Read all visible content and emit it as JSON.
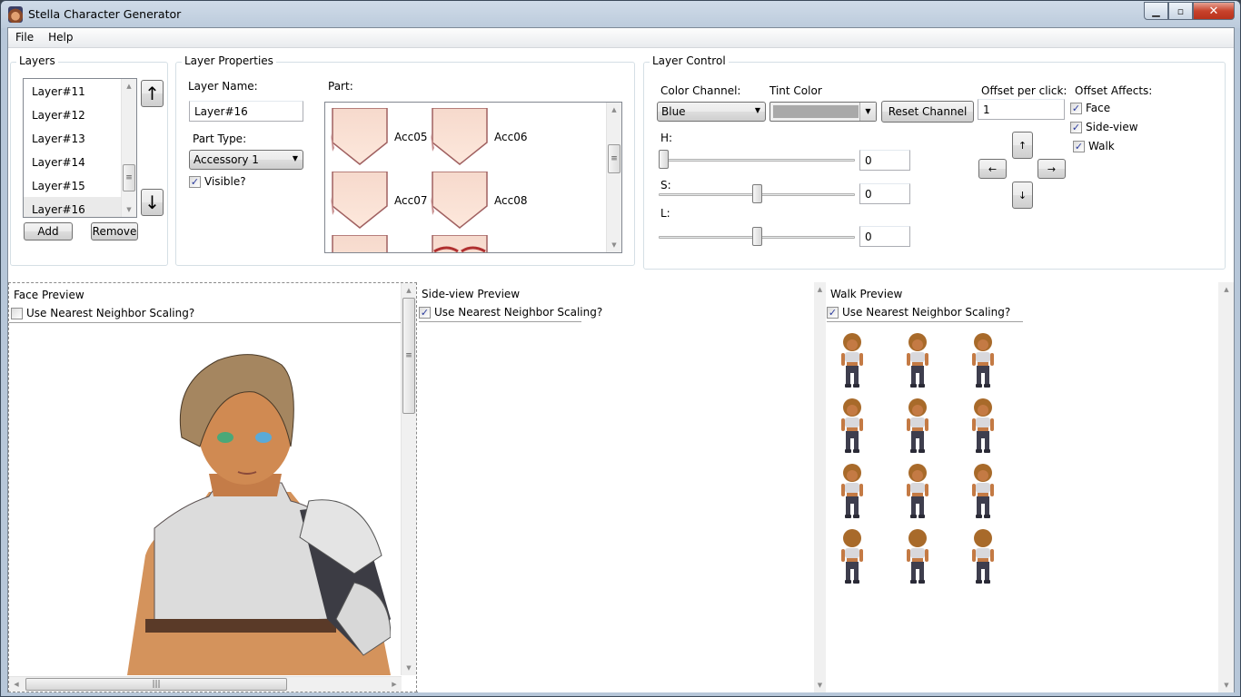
{
  "window": {
    "title": "Stella Character Generator",
    "controls": {
      "minimize": "▁",
      "maximize": "▫",
      "close": "✕"
    }
  },
  "menu": [
    {
      "label": "File"
    },
    {
      "label": "Help"
    }
  ],
  "layers": {
    "legend": "Layers",
    "items": [
      "Layer#11",
      "Layer#12",
      "Layer#13",
      "Layer#14",
      "Layer#15",
      "Layer#16"
    ],
    "selected": "Layer#16",
    "move_up": "↑",
    "move_down": "↓",
    "add_label": "Add",
    "remove_label": "Remove"
  },
  "layer_properties": {
    "legend": "Layer Properties",
    "name_label": "Layer Name:",
    "name_value": "Layer#16",
    "part_type_label": "Part Type:",
    "part_type_value": "Accessory 1",
    "visible_label": "Visible?",
    "visible_checked": true,
    "part_label": "Part:",
    "parts": [
      {
        "name": "Acc05"
      },
      {
        "name": "Acc06"
      },
      {
        "name": "Acc07"
      },
      {
        "name": "Acc08"
      },
      {
        "name": ""
      },
      {
        "name": ""
      }
    ]
  },
  "layer_control": {
    "legend": "Layer Control",
    "color_channel_label": "Color Channel:",
    "color_channel_value": "Blue",
    "tint_label": "Tint Color",
    "tint_color": "#a9a9a9",
    "reset_label": "Reset Channel",
    "h_label": "H:",
    "h_value": "0",
    "h_fraction": 0.0,
    "s_label": "S:",
    "s_value": "0",
    "s_fraction": 0.5,
    "l_label": "L:",
    "l_value": "0",
    "l_fraction": 0.5,
    "offset_label": "Offset per click:",
    "offset_value": "1",
    "arrows": {
      "up": "↑",
      "left": "←",
      "right": "→",
      "down": "↓"
    },
    "offset_affects_label": "Offset Affects:",
    "affects": [
      {
        "label": "Face",
        "checked": true
      },
      {
        "label": "Side-view",
        "checked": true
      },
      {
        "label": "Walk",
        "checked": true
      }
    ]
  },
  "face_preview": {
    "title": "Face Preview",
    "nn_label": "Use Nearest Neighbor Scaling?",
    "nn_checked": false
  },
  "side_preview": {
    "title": "Side-view Preview",
    "nn_label": "Use Nearest Neighbor Scaling?",
    "nn_checked": true
  },
  "walk_preview": {
    "title": "Walk Preview",
    "nn_label": "Use Nearest Neighbor Scaling?",
    "nn_checked": true,
    "frames": [
      {
        "dir": "down",
        "pose": "step-left"
      },
      {
        "dir": "down",
        "pose": "stand"
      },
      {
        "dir": "down",
        "pose": "step-right"
      },
      {
        "dir": "left",
        "pose": "step-left"
      },
      {
        "dir": "left",
        "pose": "stand"
      },
      {
        "dir": "left",
        "pose": "step-right"
      },
      {
        "dir": "right",
        "pose": "step-left"
      },
      {
        "dir": "right",
        "pose": "stand"
      },
      {
        "dir": "right",
        "pose": "step-right"
      },
      {
        "dir": "up",
        "pose": "step-left"
      },
      {
        "dir": "up",
        "pose": "stand"
      },
      {
        "dir": "up",
        "pose": "step-right"
      }
    ]
  },
  "scroll": {
    "up": "▲",
    "down": "▼",
    "left": "◀",
    "right": "▶",
    "grip": "≡",
    "hgrip": "|||"
  }
}
